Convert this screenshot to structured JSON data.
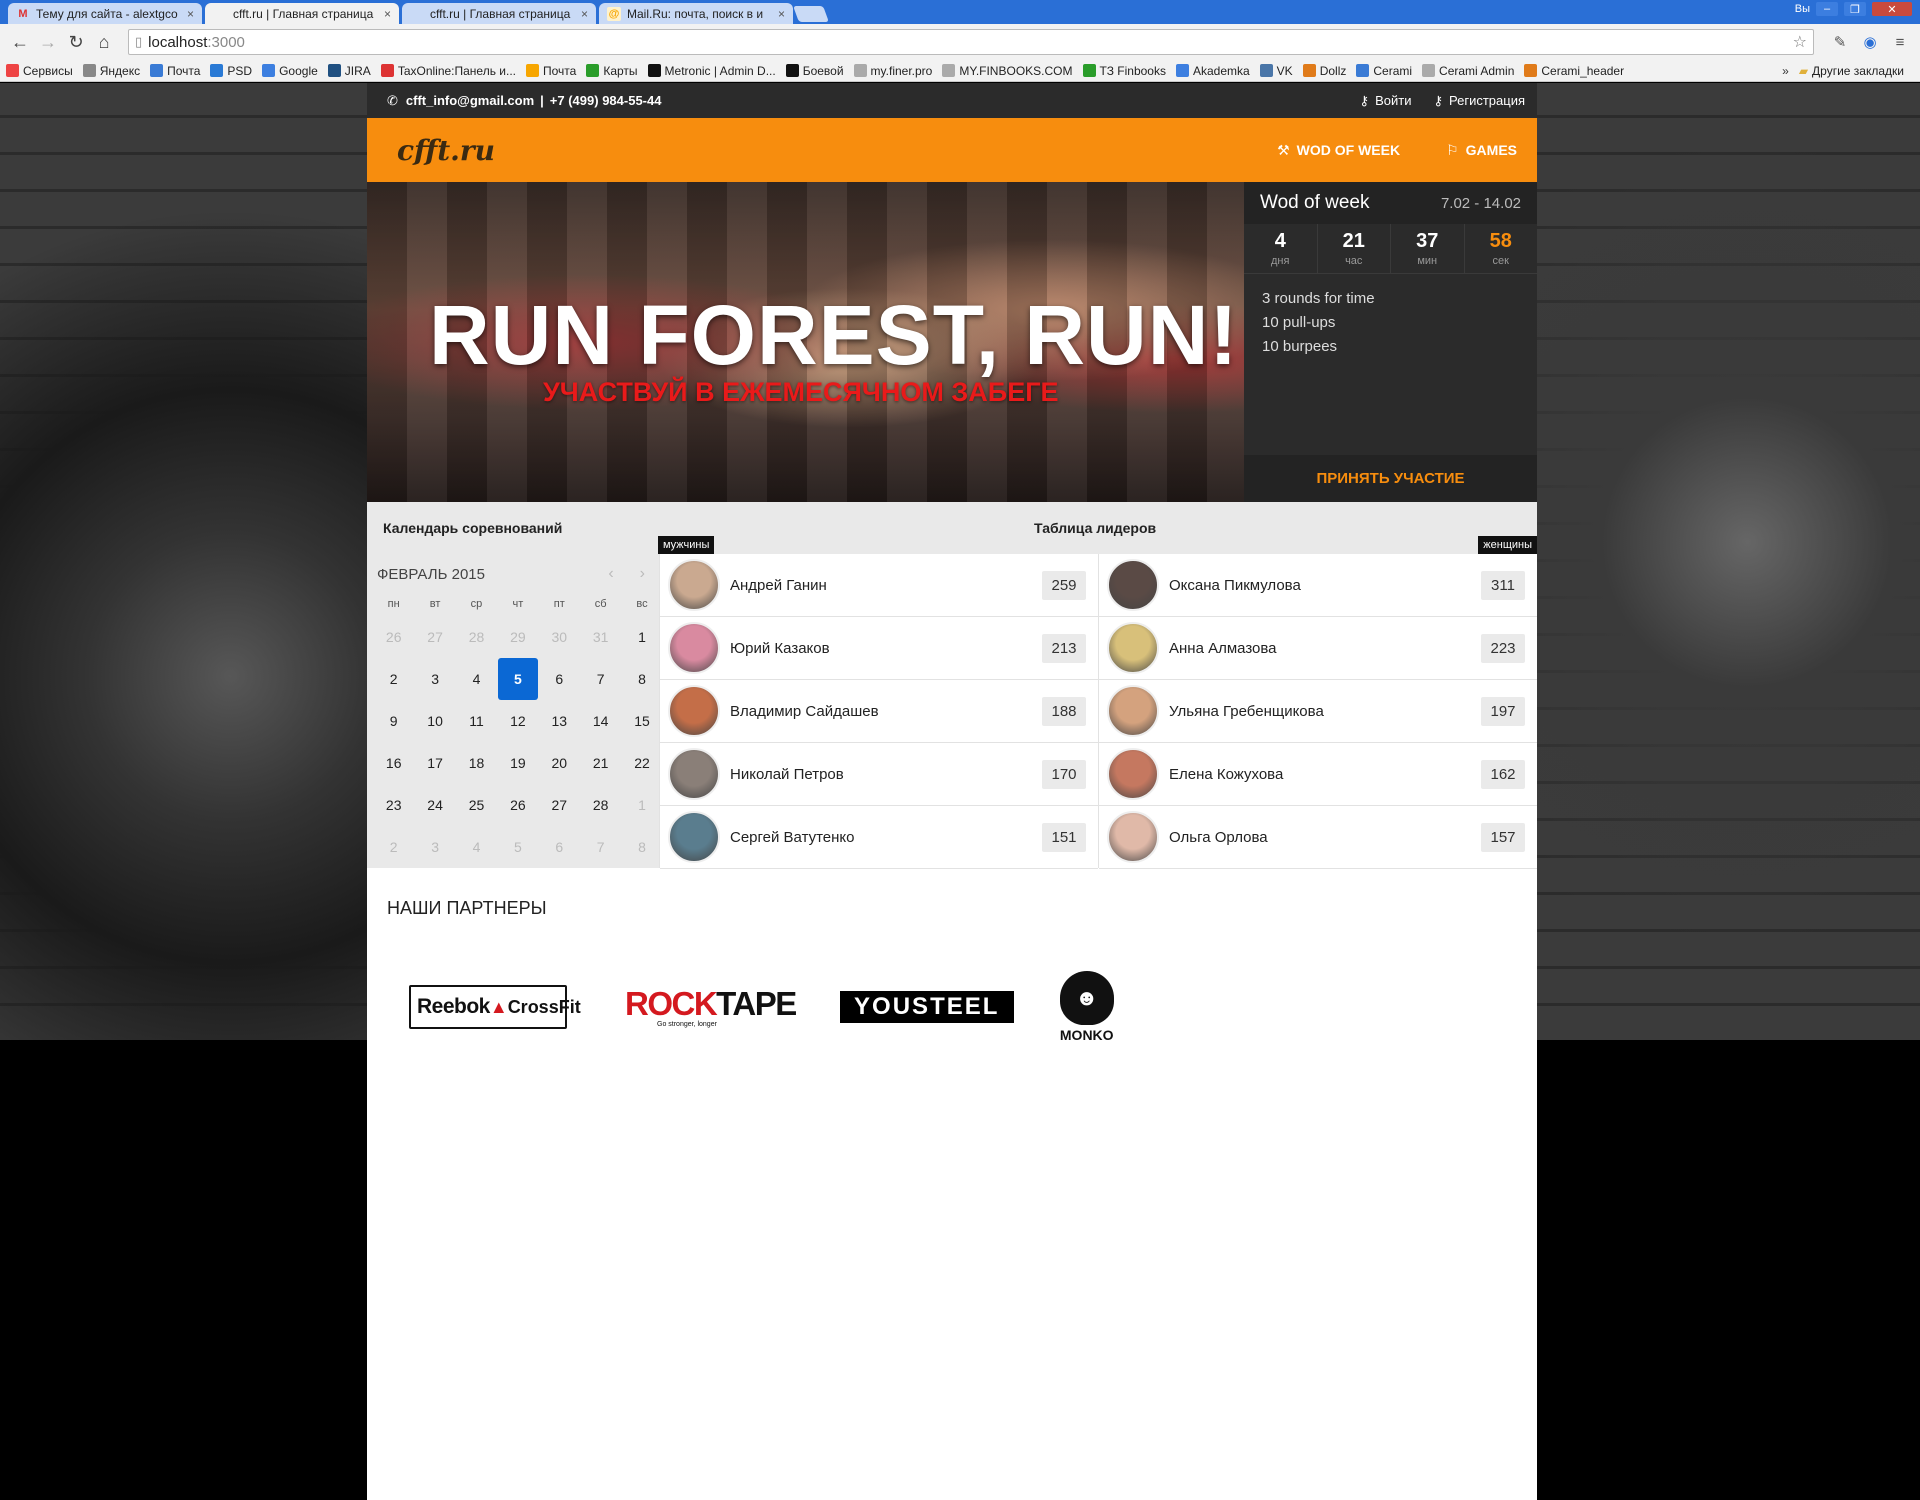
{
  "browser": {
    "tabs": [
      {
        "title": "Тему для сайта - alextgco",
        "icon": "M",
        "icon_color": "#d33"
      },
      {
        "title": "cfft.ru | Главная страница",
        "icon": "",
        "icon_color": "#ddd"
      },
      {
        "title": "cfft.ru | Главная страница",
        "icon": "",
        "icon_color": "#ddd"
      },
      {
        "title": "Mail.Ru: почта, поиск в и",
        "icon": "@",
        "icon_color": "#f7a600"
      }
    ],
    "tab_close": "×",
    "user_label": "Вы",
    "address": "localhost",
    "address_port": ":3000",
    "bookmarks": [
      {
        "label": "Сервисы",
        "color": "#e44"
      },
      {
        "label": "Яндекс",
        "color": "#888"
      },
      {
        "label": "Почта",
        "color": "#3a7bd5"
      },
      {
        "label": "PSD",
        "color": "#2a7ad5"
      },
      {
        "label": "Google",
        "color": "#3d7fe0"
      },
      {
        "label": "JIRA",
        "color": "#205081"
      },
      {
        "label": "TaxOnline:Панель и...",
        "color": "#d33"
      },
      {
        "label": "Почта",
        "color": "#f7a600"
      },
      {
        "label": "Карты",
        "color": "#2a9d2a"
      },
      {
        "label": "Metronic | Admin D...",
        "color": "#111"
      },
      {
        "label": "Боевой",
        "color": "#111"
      },
      {
        "label": "my.finer.pro",
        "color": "#aaa"
      },
      {
        "label": "MY.FINBOOKS.COM",
        "color": "#aaa"
      },
      {
        "label": "ТЗ Finbooks",
        "color": "#2a9d2a"
      },
      {
        "label": "Akademka",
        "color": "#3d7fe0"
      },
      {
        "label": "VK",
        "color": "#4a76a8"
      },
      {
        "label": "Dollz",
        "color": "#e07b1a"
      },
      {
        "label": "Cerami",
        "color": "#3a7bd5"
      },
      {
        "label": "Cerami Admin",
        "color": "#aaa"
      },
      {
        "label": "Cerami_header",
        "color": "#e07b1a"
      }
    ],
    "bookmarks_more": "»",
    "other_bookmarks": "Другие закладки"
  },
  "site": {
    "contact_email": "cfft_info@gmail.com",
    "contact_sep": "|",
    "contact_phone": "+7 (499) 984-55-44",
    "login": "Войти",
    "register": "Регистрация",
    "logo": "cfft.ru",
    "nav": [
      {
        "label": "WOD OF WEEK"
      },
      {
        "label": "GAMES"
      }
    ],
    "banner_title": "RUN FOREST, RUN!",
    "banner_subtitle": "УЧАСТВУЙ В ЕЖЕМЕСЯЧНОМ ЗАБЕГЕ",
    "wod": {
      "title": "Wod of week",
      "dates": "7.02 - 14.02",
      "countdown": [
        {
          "value": "4",
          "label": "дня"
        },
        {
          "value": "21",
          "label": "час"
        },
        {
          "value": "37",
          "label": "мин"
        },
        {
          "value": "58",
          "label": "сек"
        }
      ],
      "lines": [
        "3 rounds for time",
        "10 pull-ups",
        "10 burpees"
      ],
      "button": "ПРИНЯТЬ УЧАСТИЕ"
    },
    "calendar_heading": "Календарь соревнований",
    "leaders_heading": "Таблица лидеров",
    "men_tab": "мужчины",
    "women_tab": "женщины",
    "calendar": {
      "month": "ФЕВРАЛЬ 2015",
      "prev": "‹",
      "next": "›",
      "dow": [
        "пн",
        "вт",
        "ср",
        "чт",
        "пт",
        "сб",
        "вс"
      ],
      "weeks": [
        [
          "26",
          "27",
          "28",
          "29",
          "30",
          "31",
          "1"
        ],
        [
          "2",
          "3",
          "4",
          "5",
          "6",
          "7",
          "8"
        ],
        [
          "9",
          "10",
          "11",
          "12",
          "13",
          "14",
          "15"
        ],
        [
          "16",
          "17",
          "18",
          "19",
          "20",
          "21",
          "22"
        ],
        [
          "23",
          "24",
          "25",
          "26",
          "27",
          "28",
          "1"
        ],
        [
          "2",
          "3",
          "4",
          "5",
          "6",
          "7",
          "8"
        ]
      ],
      "today": "5"
    },
    "men": [
      {
        "name": "Андрей Ганин",
        "score": "259",
        "avatar_color": "#caa990"
      },
      {
        "name": "Юрий Казаков",
        "score": "213",
        "avatar_color": "#d98aa0"
      },
      {
        "name": "Владимир Сайдашев",
        "score": "188",
        "avatar_color": "#c46e48"
      },
      {
        "name": "Николай Петров",
        "score": "170",
        "avatar_color": "#8a7f78"
      },
      {
        "name": "Сергей Ватутенко",
        "score": "151",
        "avatar_color": "#5a7d8e"
      }
    ],
    "women": [
      {
        "name": "Оксана Пикмулова",
        "score": "311",
        "avatar_color": "#5a4a45"
      },
      {
        "name": "Анна Алмазова",
        "score": "223",
        "avatar_color": "#d8c07a"
      },
      {
        "name": "Ульяна Гребенщикова",
        "score": "197",
        "avatar_color": "#d4a27e"
      },
      {
        "name": "Елена Кожухова",
        "score": "162",
        "avatar_color": "#c57860"
      },
      {
        "name": "Ольга Орлова",
        "score": "157",
        "avatar_color": "#e0b9a8"
      }
    ],
    "partners_heading": "НАШИ ПАРТНЕРЫ",
    "partners": {
      "reebok_a": "Reebok",
      "reebok_b": "CrossFit",
      "rocktape_a": "ROCK",
      "rocktape_b": "TAPE",
      "rocktape_tag": "Go stronger, longer",
      "yousteel": "YOUSTEEL",
      "monko": "MONKO"
    }
  }
}
